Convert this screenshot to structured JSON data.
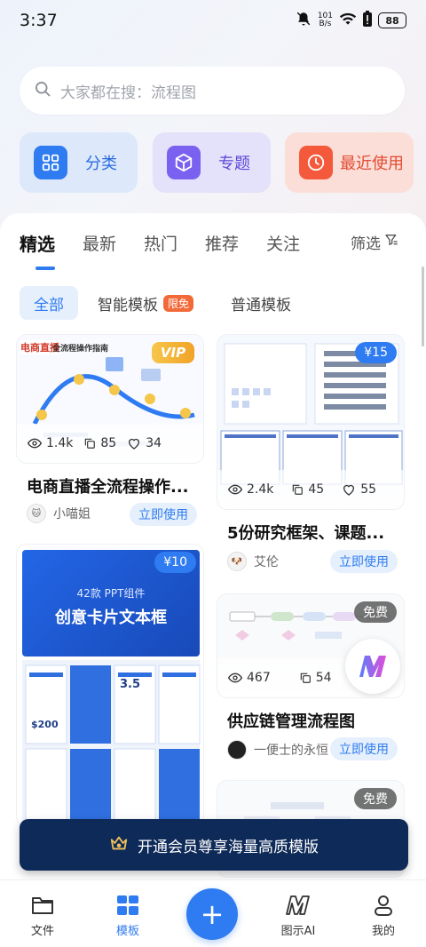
{
  "status": {
    "time": "3:37",
    "net_speed_value": "101",
    "net_speed_unit": "B/s",
    "battery": "88"
  },
  "search": {
    "placeholder": "大家都在搜：流程图",
    "icon": "search-icon"
  },
  "shortcuts": [
    {
      "label": "分类",
      "icon": "grid-icon"
    },
    {
      "label": "专题",
      "icon": "cube-icon"
    },
    {
      "label": "最近使用",
      "icon": "clock-icon"
    }
  ],
  "tabs": [
    "精选",
    "最新",
    "热门",
    "推荐",
    "关注"
  ],
  "filter_label": "筛选",
  "chips": {
    "all": "全部",
    "smart": "智能模板",
    "smart_badge": "限免",
    "normal": "普通模板"
  },
  "cards": {
    "c1": {
      "badge": "VIP",
      "views": "1.4k",
      "copies": "85",
      "likes": "34",
      "title": "电商直播全流程操作...",
      "author": "小喵姐",
      "use_label": "立即使用",
      "thumb_title": "全流程操作指南",
      "thumb_brand": "电商直播"
    },
    "c2": {
      "price": "¥15",
      "views": "2.4k",
      "copies": "45",
      "likes": "55",
      "title": "5份研究框架、课题...",
      "author": "艾伦",
      "use_label": "立即使用"
    },
    "c3": {
      "price": "¥10",
      "thumb_sub": "42款 PPT组件",
      "thumb_title": "创意卡片文本框",
      "thumb_price": "$200",
      "thumb_num": "3.5"
    },
    "c4": {
      "price": "免费",
      "views": "467",
      "copies": "54",
      "title": "供应链管理流程图",
      "author": "一便士的永恒",
      "use_label": "立即使用"
    },
    "c5": {
      "price": "免费"
    }
  },
  "vip_banner": {
    "text": "开通会员尊享海量高质模版"
  },
  "nav": [
    {
      "label": "文件",
      "icon": "folder-icon"
    },
    {
      "label": "模板",
      "icon": "template-icon"
    },
    {
      "label": "图示AI",
      "icon": "ai-logo-icon"
    },
    {
      "label": "我的",
      "icon": "user-icon"
    }
  ],
  "colors": {
    "accent": "#2f7bf1",
    "banner": "#0e2a58",
    "vip_gold": "#f0a326",
    "badge_orange": "#f26a3a"
  }
}
